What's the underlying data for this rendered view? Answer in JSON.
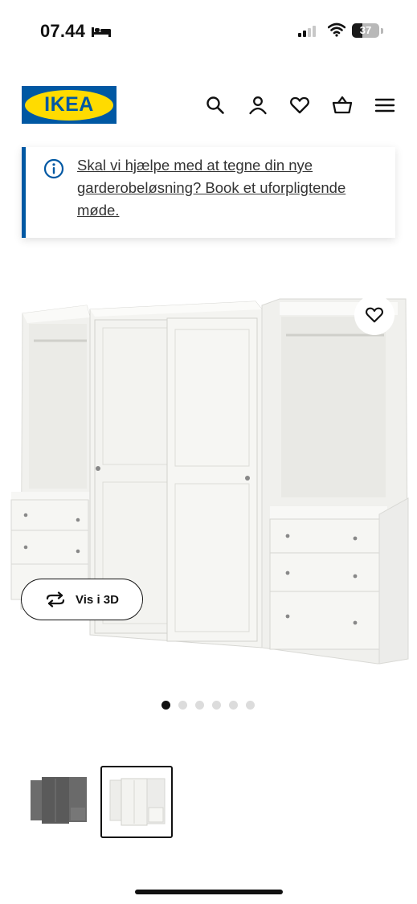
{
  "status_bar": {
    "time": "07.44",
    "battery_level": "37",
    "battery_fraction": 0.37,
    "icons": [
      "bed-icon",
      "signal-icon",
      "wifi-icon",
      "battery-icon"
    ]
  },
  "header": {
    "logo_text": "IKEA",
    "brand_colors": {
      "blue": "#0058a3",
      "yellow": "#ffdb00"
    },
    "icons": [
      "search-icon",
      "account-icon",
      "heart-icon",
      "basket-icon",
      "menu-icon"
    ]
  },
  "info_banner": {
    "icon": "info-icon",
    "text": "Skal vi hjælpe med at tegne din nye garderobeløsning? Book et uforpligtende møde.",
    "accent_color": "#0058a3"
  },
  "product": {
    "image_description_icon": "wardrobe-image",
    "wishlist_icon": "heart-icon",
    "view_3d_label": "Vis i 3D",
    "view_3d_icon": "rotate-icon"
  },
  "carousel": {
    "total_slides": 6,
    "active_index": 0
  },
  "thumbnails": {
    "count": 2,
    "selected_index": 1,
    "variants": [
      "grey-wardrobe-thumbnail",
      "white-wardrobe-thumbnail"
    ]
  }
}
